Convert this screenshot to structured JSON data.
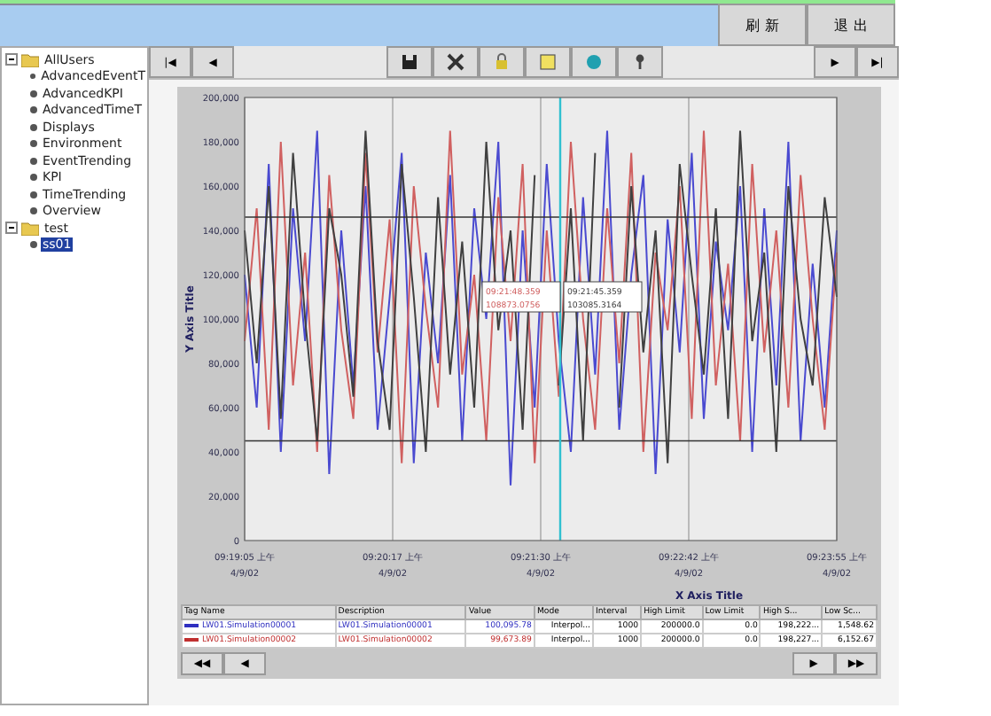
{
  "header": {
    "buttons": [
      "刷 新",
      "退 出"
    ]
  },
  "tree": [
    {
      "label": "AllUsers",
      "expanded": true,
      "children": [
        {
          "label": "AdvancedEventT"
        },
        {
          "label": "AdvancedKPI"
        },
        {
          "label": "AdvancedTimeT"
        },
        {
          "label": "Displays"
        },
        {
          "label": "Environment"
        },
        {
          "label": "EventTrending"
        },
        {
          "label": "KPI"
        },
        {
          "label": "TimeTrending"
        },
        {
          "label": "Overview"
        }
      ]
    },
    {
      "label": "test",
      "expanded": true,
      "children": [
        {
          "label": "ss01",
          "selected": true
        }
      ]
    }
  ],
  "toolbar": {
    "left": [
      "|◀",
      "◀"
    ],
    "right": [
      "▶",
      "▶|"
    ]
  },
  "chart": {
    "xticks": [
      {
        "time": "09:19:05 上午",
        "date": "4/9/02"
      },
      {
        "time": "09:20:17 上午",
        "date": "4/9/02"
      },
      {
        "time": "09:21:30 上午",
        "date": "4/9/02"
      },
      {
        "time": "09:22:42 上午",
        "date": "4/9/02"
      },
      {
        "time": "09:23:55 上午",
        "date": "4/9/02"
      }
    ],
    "tooltips": [
      {
        "time": "09:21:48.359",
        "value": "108873.0756"
      },
      {
        "time": "09:21:45.359",
        "value": "103085.3164"
      }
    ],
    "chart_data": {
      "type": "line",
      "ylabel": "Y Axis Title",
      "xlabel": "X Axis Title",
      "ylim": [
        0,
        200000
      ],
      "ref_lines": [
        {
          "axis": "y",
          "value": 146000,
          "color": "#333333"
        },
        {
          "axis": "y",
          "value": 45000,
          "color": "#333333"
        }
      ],
      "yticks": [
        {
          "value": 200000,
          "label": "200,000"
        },
        {
          "value": 180000,
          "label": "180,000"
        },
        {
          "value": 160000,
          "label": "160,000"
        },
        {
          "value": 140000,
          "label": "140,000"
        },
        {
          "value": 120000,
          "label": "120,000"
        },
        {
          "value": 100000,
          "label": "100,000"
        },
        {
          "value": 80000,
          "label": "80,000"
        },
        {
          "value": 60000,
          "label": "60,000"
        },
        {
          "value": 40000,
          "label": "40,000"
        },
        {
          "value": 20000,
          "label": "20,000"
        },
        {
          "value": 0,
          "label": "0"
        }
      ],
      "series": [
        {
          "color": "#4a4ad0",
          "values": [
            120000,
            60000,
            170000,
            40000,
            150000,
            90000,
            185000,
            30000,
            140000,
            70000,
            160000,
            50000,
            110000,
            175000,
            35000,
            130000,
            80000,
            165000,
            45000,
            150000,
            100000,
            180000,
            25000,
            140000,
            60000,
            170000,
            90000,
            40000,
            155000,
            75000,
            185000,
            50000,
            120000,
            165000,
            30000,
            145000,
            85000,
            175000,
            55000,
            135000,
            95000,
            160000,
            40000,
            150000,
            70000,
            180000,
            45000,
            125000,
            60000,
            140000
          ]
        },
        {
          "color": "#d06060",
          "values": [
            90000,
            150000,
            50000,
            180000,
            70000,
            130000,
            40000,
            165000,
            95000,
            55000,
            175000,
            85000,
            145000,
            35000,
            160000,
            105000,
            60000,
            185000,
            75000,
            120000,
            45000,
            155000,
            90000,
            170000,
            35000,
            140000,
            65000,
            180000,
            100000,
            50000,
            150000,
            80000,
            175000,
            40000,
            130000,
            95000,
            160000,
            55000,
            185000,
            70000,
            125000,
            45000,
            170000,
            85000,
            140000,
            60000,
            165000,
            100000,
            50000,
            130000
          ]
        },
        {
          "color": "#404040",
          "values": [
            140000,
            80000,
            160000,
            55000,
            175000,
            100000,
            45000,
            150000,
            120000,
            65000,
            185000,
            90000,
            50000,
            170000,
            110000,
            40000,
            155000,
            75000,
            135000,
            60000,
            180000,
            95000,
            140000,
            50000,
            165000,
            null,
            70000,
            150000,
            45000,
            175000,
            null,
            60000,
            160000,
            85000,
            140000,
            35000,
            170000,
            120000,
            75000,
            150000,
            55000,
            185000,
            90000,
            130000,
            40000,
            160000,
            100000,
            70000,
            155000,
            110000
          ]
        }
      ]
    }
  },
  "table": {
    "columns": [
      "Tag Name",
      "Description",
      "Value",
      "Mode",
      "Interval",
      "High Limit",
      "Low Limit",
      "High S...",
      "Low Sc..."
    ],
    "rows": [
      {
        "color": "#3030c0",
        "cells": [
          "LW01.Simulation00001",
          "LW01.Simulation00001",
          "100,095.78",
          "Interpol...",
          "1000",
          "200000.0",
          "0.0",
          "198,222...",
          "1,548.62"
        ]
      },
      {
        "color": "#c03030",
        "cells": [
          "LW01.Simulation00002",
          "LW01.Simulation00002",
          "99,673.89",
          "Interpol...",
          "1000",
          "200000.0",
          "0.0",
          "198,227...",
          "6,152.67"
        ]
      }
    ]
  },
  "bottom": {
    "left": [
      "◀◀",
      "◀"
    ],
    "right": [
      "▶",
      "▶▶"
    ]
  }
}
